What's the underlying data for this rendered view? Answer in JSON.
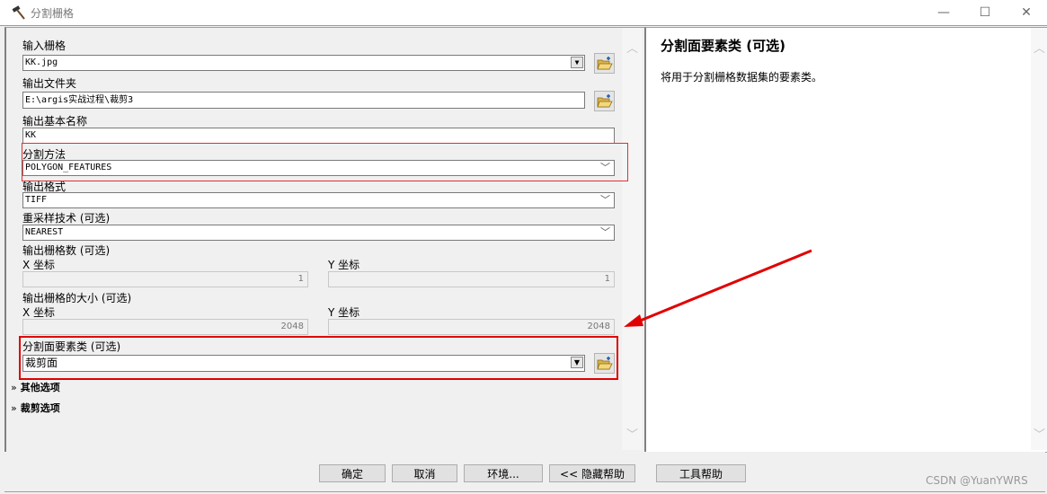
{
  "window": {
    "title": "分割栅格",
    "icon": "hammer-icon",
    "controls": {
      "minimize": "—",
      "maximize": "☐",
      "close": "✕"
    }
  },
  "form": {
    "input_raster": {
      "label": "输入栅格",
      "value": "KK.jpg"
    },
    "output_folder": {
      "label": "输出文件夹",
      "value": "E:\\argis实战过程\\裁剪3"
    },
    "output_base_name": {
      "label": "输出基本名称",
      "value": "KK"
    },
    "split_method": {
      "label": "分割方法",
      "value": "POLYGON_FEATURES"
    },
    "output_format": {
      "label": "输出格式",
      "value": "TIFF"
    },
    "resampling": {
      "label": "重采样技术 (可选)",
      "value": "NEAREST"
    },
    "num_rasters": {
      "label": "输出栅格数 (可选)",
      "x_label": "X 坐标",
      "x_value": "1",
      "y_label": "Y 坐标",
      "y_value": "1"
    },
    "cell_size": {
      "label": "输出栅格的大小 (可选)",
      "x_label": "X 坐标",
      "x_value": "2048",
      "y_label": "Y 坐标",
      "y_value": "2048"
    },
    "split_polygon": {
      "label": "分割面要素类 (可选)",
      "value": "裁剪面"
    },
    "sections": [
      {
        "label": "其他选项",
        "icon": "expand-chevrons-icon"
      },
      {
        "label": "裁剪选项",
        "icon": "expand-chevrons-icon"
      }
    ]
  },
  "help": {
    "title": "分割面要素类 (可选)",
    "text": "将用于分割栅格数据集的要素类。"
  },
  "buttons": {
    "ok": "确定",
    "cancel": "取消",
    "environments": "环境...",
    "hide_help": "<< 隐藏帮助",
    "tool_help": "工具帮助"
  },
  "annotation": {
    "color": "#e00000"
  },
  "watermark": "CSDN @YuanYWRS"
}
